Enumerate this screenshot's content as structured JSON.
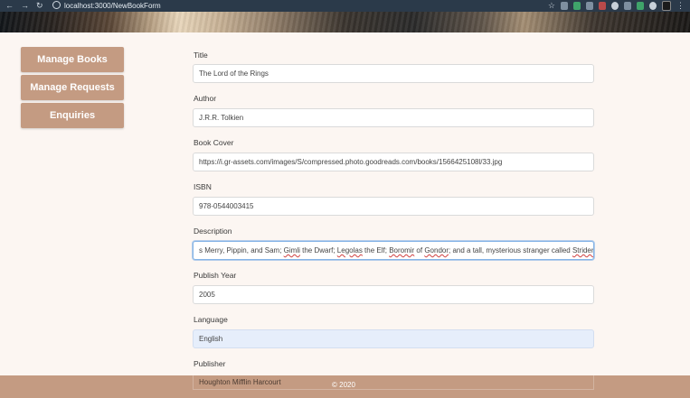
{
  "browser": {
    "address": "localhost:3000/NewBookForm"
  },
  "sidebar": {
    "items": [
      {
        "label": "Manage Books"
      },
      {
        "label": "Manage Requests"
      },
      {
        "label": "Enquiries"
      }
    ]
  },
  "form": {
    "title": {
      "label": "Title",
      "value": "The Lord of the Rings"
    },
    "author": {
      "label": "Author",
      "value": "J.R.R. Tolkien"
    },
    "cover": {
      "label": "Book Cover",
      "value": "https://i.gr-assets.com/images/S/compressed.photo.goodreads.com/books/1566425108l/33.jpg"
    },
    "isbn": {
      "label": "ISBN",
      "value": "978-0544003415"
    },
    "description": {
      "label": "Description",
      "parts": [
        "s Merry, Pippin, and Sam; ",
        "Gimli",
        " the Dwarf; ",
        "Legolas",
        " the Elf; ",
        "Boromir",
        " of ",
        "Gondor",
        "; and a tall, mysterious stranger called ",
        "Strider",
        "."
      ]
    },
    "year": {
      "label": "Publish Year",
      "value": "2005"
    },
    "language": {
      "label": "Language",
      "value": "English"
    },
    "publisher": {
      "label": "Publisher",
      "value": "Houghton Mifflin Harcourt"
    }
  },
  "footer": {
    "copyright": "© 2020"
  }
}
